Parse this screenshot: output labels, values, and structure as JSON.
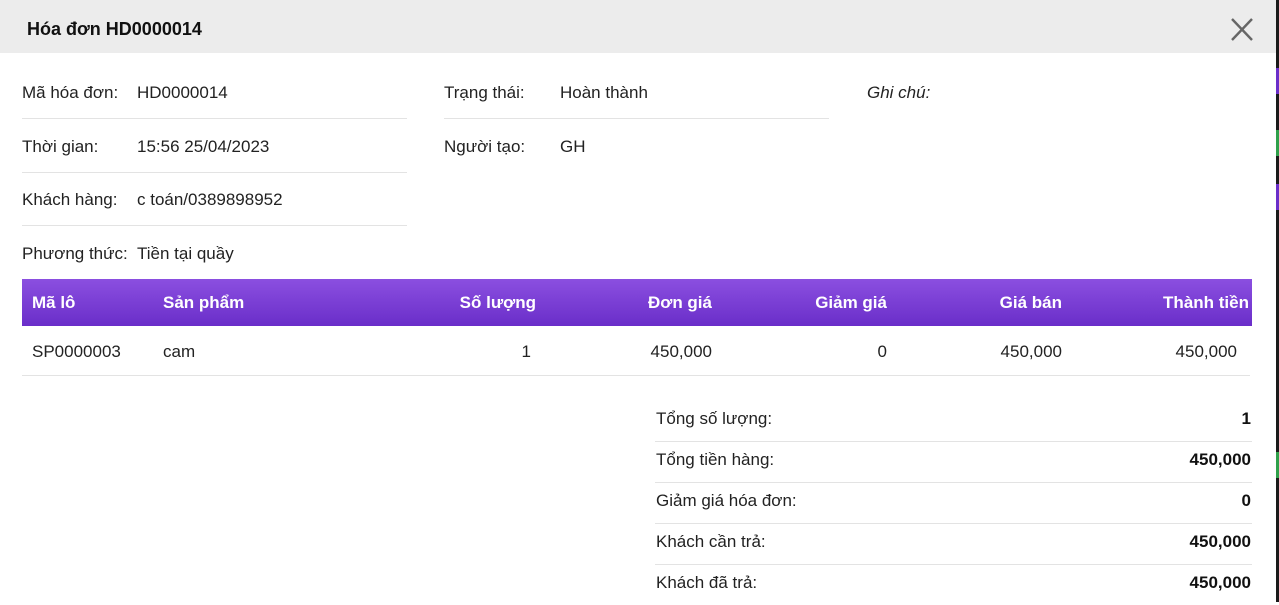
{
  "modal": {
    "title": "Hóa đơn HD0000014"
  },
  "info": {
    "invoice_code_label": "Mã hóa đơn:",
    "invoice_code": "HD0000014",
    "time_label": "Thời gian:",
    "time": "15:56 25/04/2023",
    "customer_label": "Khách hàng:",
    "customer": "c toán/0389898952",
    "method_label": "Phương thức:",
    "method": "Tiền tại quầy",
    "status_label": "Trạng thái:",
    "status": "Hoàn thành",
    "creator_label": "Người tạo:",
    "creator": "GH",
    "note_label": "Ghi chú:"
  },
  "table": {
    "headers": [
      "Mã lô",
      "Sản phẩm",
      "Số lượng",
      "Đơn giá",
      "Giảm giá",
      "Giá bán",
      "Thành tiền"
    ],
    "rows": [
      [
        "SP0000003",
        "cam",
        "1",
        "450,000",
        "0",
        "450,000",
        "450,000"
      ]
    ]
  },
  "summary": [
    {
      "label": "Tổng số lượng:",
      "value": "1"
    },
    {
      "label": "Tổng tiền hàng:",
      "value": "450,000"
    },
    {
      "label": "Giảm giá hóa đơn:",
      "value": "0"
    },
    {
      "label": "Khách cần trả:",
      "value": "450,000"
    },
    {
      "label": "Khách đã trả:",
      "value": "450,000"
    }
  ],
  "colors": {
    "header_bg": "#ececec",
    "table_header_start": "#8b4fe0",
    "table_header_end": "#6a2ec9"
  }
}
